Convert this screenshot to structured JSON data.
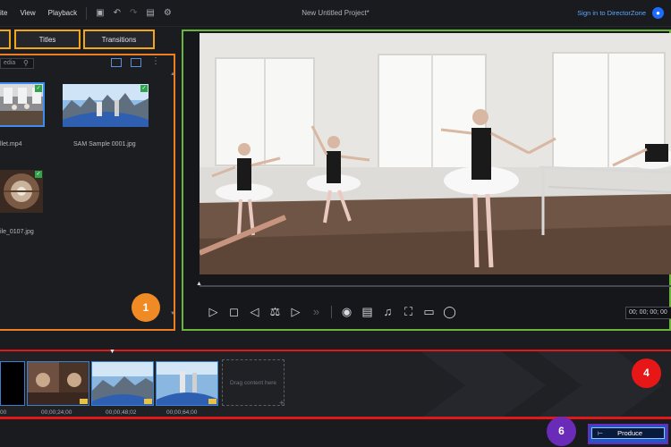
{
  "menu": {
    "items": [
      "ite",
      "View",
      "Playback"
    ],
    "project_title": "New Untitled Project*",
    "signin": "Sign in to DirectorZone",
    "user_icon": "user-icon"
  },
  "library": {
    "tabs": [
      "",
      "Titles",
      "Transitions"
    ],
    "search_text": "edia",
    "items": [
      {
        "name": "llet.mp4",
        "icon": "video-thumbnail"
      },
      {
        "name": "SAM Sample 0001.jpg",
        "icon": "image-thumbnail"
      },
      {
        "name": "ile_0107.jpg",
        "icon": "image-thumbnail"
      }
    ],
    "badge": "1"
  },
  "preview": {
    "timecode": "00; 00; 00; 00"
  },
  "timeline": {
    "placeholder": "Drag content here",
    "timecodes": [
      "00",
      "00;00;24;00",
      "00;00;48;02",
      "00;00;64;00"
    ],
    "badge": "4"
  },
  "bottom": {
    "produce_label": "Produce",
    "badge": "6"
  },
  "colors": {
    "tabs_highlight": "#f1a718",
    "library_highlight": "#ef7d22",
    "preview_highlight": "#69b63b",
    "timeline_highlight": "#e01818",
    "produce_highlight": "#6a2bb8"
  }
}
